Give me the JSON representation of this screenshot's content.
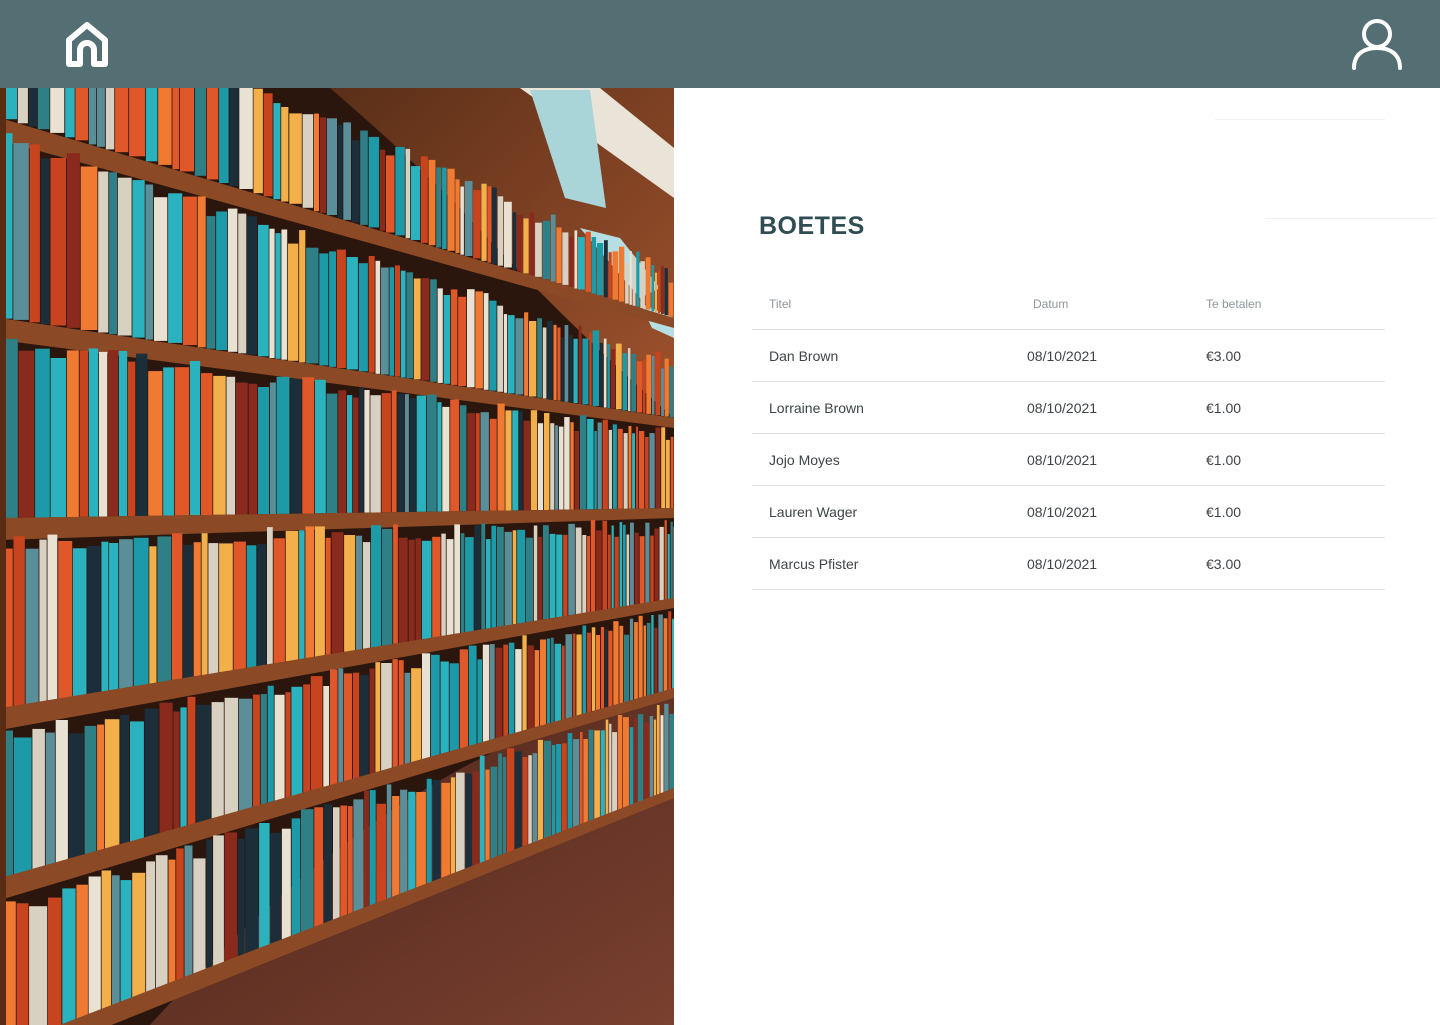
{
  "header": {
    "home_icon": "home-icon",
    "user_icon": "user-icon",
    "background_color": "#536f73"
  },
  "hero_image": {
    "subject": "library bookshelves"
  },
  "fines": {
    "title": "BOETES",
    "columns": [
      "Titel",
      "Datum",
      "Te betalen"
    ],
    "rows": [
      {
        "title": "Dan Brown",
        "date": "08/10/2021",
        "amount": "€3.00"
      },
      {
        "title": "Lorraine Brown",
        "date": "08/10/2021",
        "amount": "€1.00"
      },
      {
        "title": "Jojo Moyes",
        "date": "08/10/2021",
        "amount": "€1.00"
      },
      {
        "title": "Lauren Wager",
        "date": "08/10/2021",
        "amount": "€1.00"
      },
      {
        "title": "Marcus Pfister",
        "date": "08/10/2021",
        "amount": "€3.00"
      }
    ]
  }
}
